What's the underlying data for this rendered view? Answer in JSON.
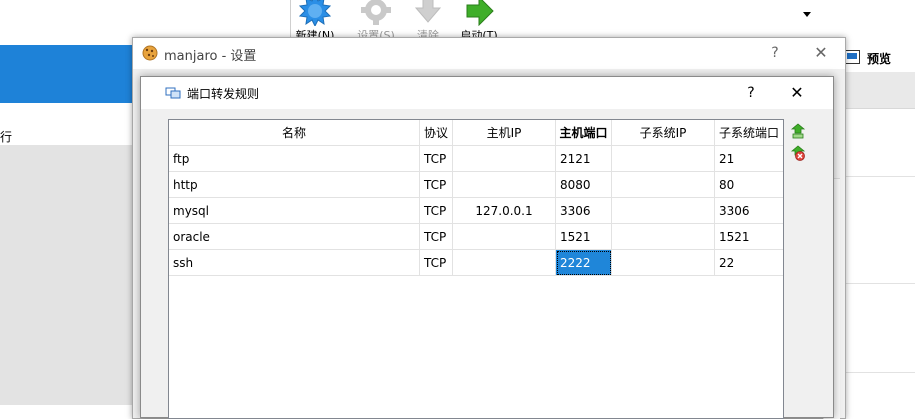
{
  "manager": {
    "selected_vm_text": "",
    "side_text1": "",
    "side_text2": "行",
    "toolbar": [
      {
        "label": "新建(N)",
        "icon": "new-vm-icon",
        "disabled": false
      },
      {
        "label": "设置(S)",
        "icon": "settings-gear-icon",
        "disabled": true
      },
      {
        "label": "清除",
        "icon": "discard-arrow-icon",
        "disabled": true
      },
      {
        "label": "启动(T)",
        "icon": "start-arrow-icon",
        "disabled": false
      }
    ],
    "preview_label": "预览"
  },
  "settings_window": {
    "title": "manjaro - 设置",
    "help": "?",
    "close": "✕"
  },
  "port_forwarding": {
    "title": "端口转发规则",
    "help": "?",
    "close": "✕",
    "columns": [
      "名称",
      "协议",
      "主机IP",
      "主机端口",
      "子系统IP",
      "子系统端口"
    ],
    "rows": [
      {
        "name": "ftp",
        "protocol": "TCP",
        "host_ip": "",
        "host_port": "2121",
        "guest_ip": "",
        "guest_port": "21"
      },
      {
        "name": "http",
        "protocol": "TCP",
        "host_ip": "",
        "host_port": "8080",
        "guest_ip": "",
        "guest_port": "80"
      },
      {
        "name": "mysql",
        "protocol": "TCP",
        "host_ip": "127.0.0.1",
        "host_port": "3306",
        "guest_ip": "",
        "guest_port": "3306"
      },
      {
        "name": "oracle",
        "protocol": "TCP",
        "host_ip": "",
        "host_port": "1521",
        "guest_ip": "",
        "guest_port": "1521"
      },
      {
        "name": "ssh",
        "protocol": "TCP",
        "host_ip": "",
        "host_port": "2222",
        "guest_ip": "",
        "guest_port": "22"
      }
    ],
    "selected_cell": {
      "row": 4,
      "column": "host_port"
    }
  },
  "colors": {
    "selection": "#1f86d9",
    "accent_green": "#3fae29",
    "new_vm_blue": "#2b8fe6"
  }
}
